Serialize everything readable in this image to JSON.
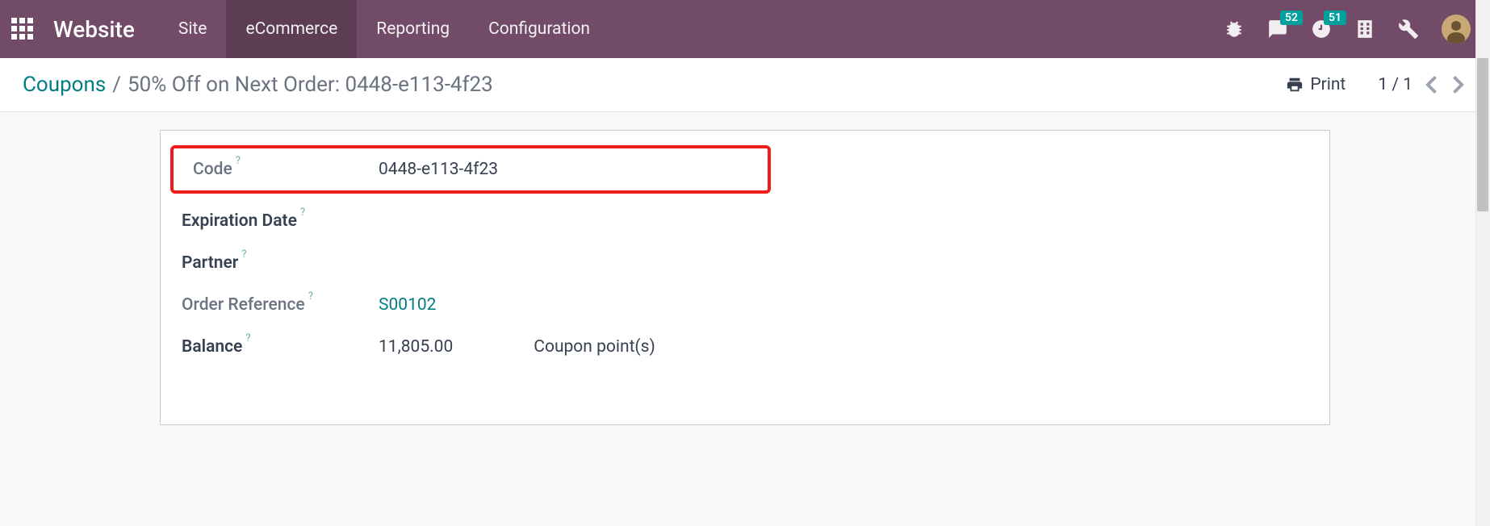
{
  "nav": {
    "brand": "Website",
    "items": [
      "Site",
      "eCommerce",
      "Reporting",
      "Configuration"
    ],
    "active_index": 1,
    "badges": {
      "messages": "52",
      "activities": "51"
    }
  },
  "breadcrumb": {
    "root": "Coupons",
    "sep": "/",
    "current": "50% Off on Next Order: 0448-e113-4f23",
    "print": "Print",
    "pager": "1 / 1"
  },
  "form": {
    "code": {
      "label": "Code",
      "value": "0448-e113-4f23"
    },
    "expiration": {
      "label": "Expiration Date",
      "value": ""
    },
    "partner": {
      "label": "Partner",
      "value": ""
    },
    "order_ref": {
      "label": "Order Reference",
      "value": "S00102"
    },
    "balance": {
      "label": "Balance",
      "value": "11,805.00",
      "unit": "Coupon point(s)"
    },
    "help": "?"
  }
}
